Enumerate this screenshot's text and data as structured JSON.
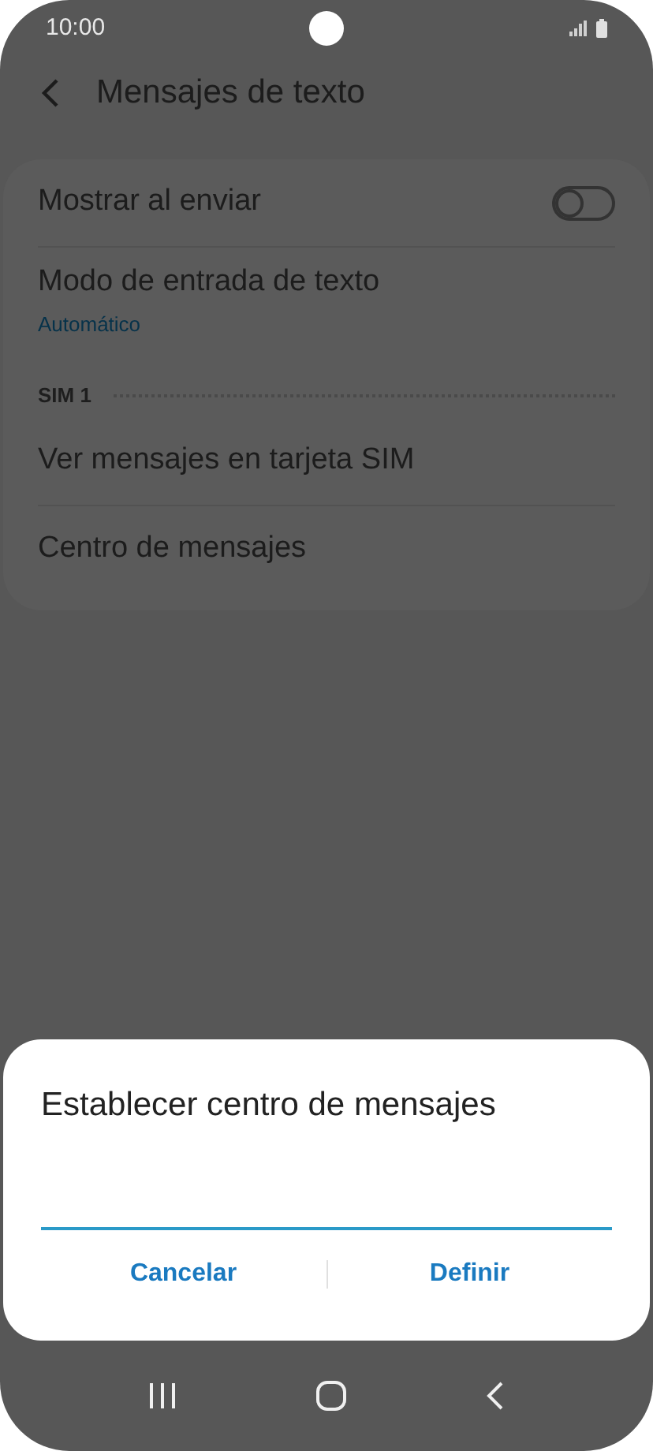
{
  "status_bar": {
    "time": "10:00"
  },
  "header": {
    "title": "Mensajes de texto"
  },
  "settings": [
    {
      "kind": "switch",
      "label": "Mostrar al enviar",
      "on": false
    },
    {
      "kind": "item",
      "label": "Modo de entrada de texto",
      "subtitle": "Automático"
    },
    {
      "kind": "section",
      "label": "SIM 1"
    },
    {
      "kind": "item",
      "label": "Ver mensajes en tarjeta SIM"
    },
    {
      "kind": "item",
      "label": "Centro de mensajes"
    }
  ],
  "dialog": {
    "title": "Establecer centro de mensajes",
    "buttons": [
      "Cancelar",
      "Definir"
    ]
  }
}
